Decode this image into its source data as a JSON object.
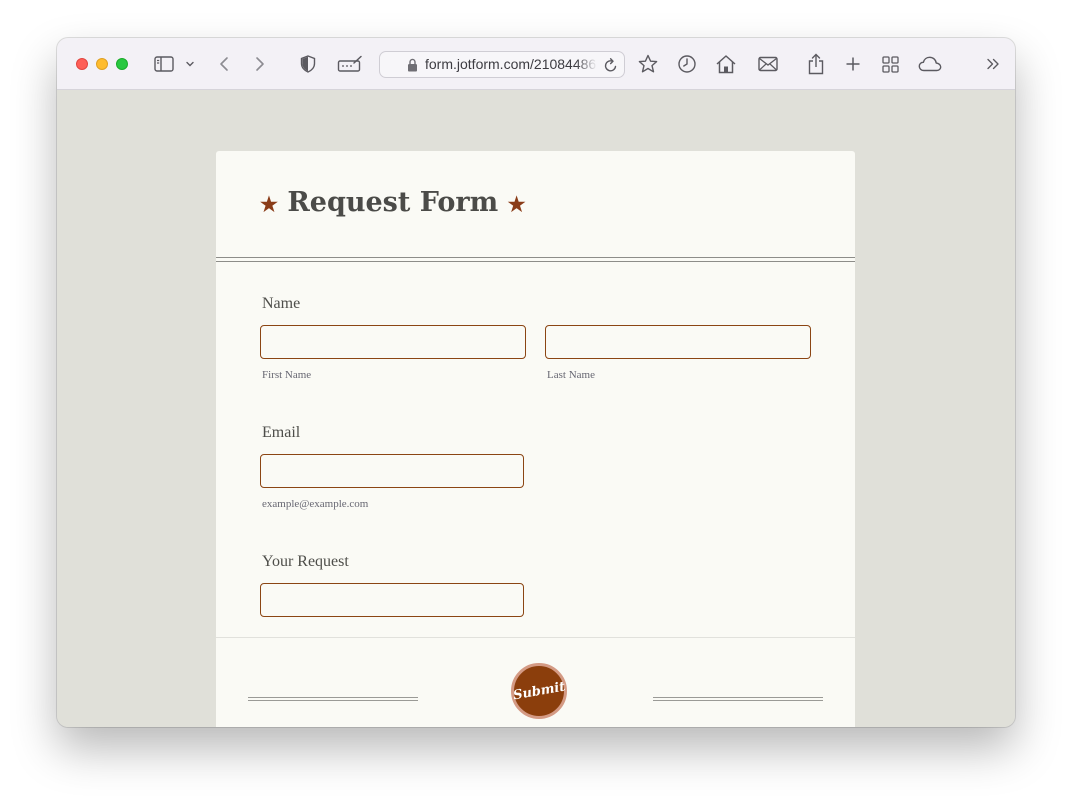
{
  "browser": {
    "url": "form.jotform.com/21084486",
    "icons": [
      "sidebar-icon",
      "chevron-down-icon",
      "back-icon",
      "forward-icon",
      "privacy-shield-icon",
      "signature-icon",
      "lock-icon",
      "reload-icon",
      "bookmark-star-icon",
      "history-icon",
      "home-icon",
      "mail-icon",
      "share-icon",
      "new-tab-plus-icon",
      "tab-overview-grid-icon",
      "cloud-icon",
      "more-chevrons-icon"
    ]
  },
  "form": {
    "title": "Request Form",
    "title_star": "★",
    "name": {
      "label": "Name",
      "first_sublabel": "First Name",
      "last_sublabel": "Last Name",
      "first_value": "",
      "last_value": ""
    },
    "email": {
      "label": "Email",
      "sublabel": "example@example.com",
      "value": ""
    },
    "request": {
      "label": "Your Request",
      "value": ""
    },
    "submit_label": "Submit"
  },
  "colors": {
    "accent": "#8b4513",
    "submit_fill": "#8b3e0c",
    "submit_ring": "#d49a84",
    "page_bg": "#e0e0d9",
    "card_bg": "#fafaf5"
  }
}
